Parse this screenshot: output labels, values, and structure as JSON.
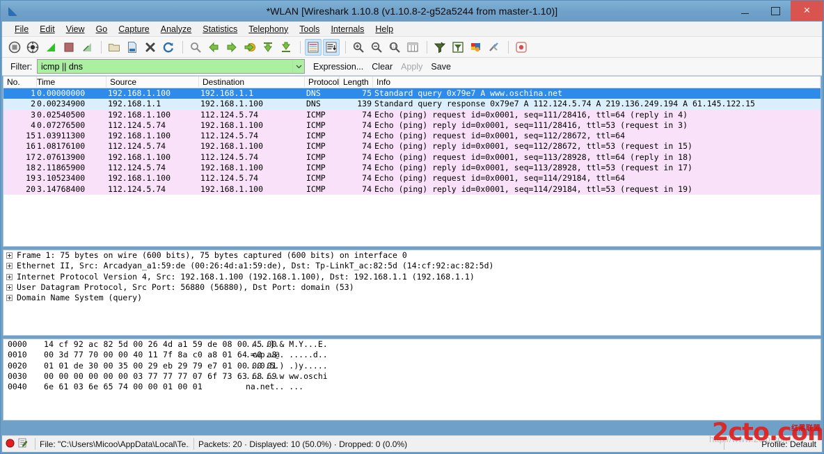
{
  "window": {
    "title": "*WLAN  [Wireshark 1.10.8 (v1.10.8-2-g52a5244 from master-1.10)]",
    "logo_icon": "wireshark-fin-icon",
    "minimize_label": "",
    "maximize_label": "",
    "close_label": "×"
  },
  "menubar": {
    "items": [
      {
        "label": "File"
      },
      {
        "label": "Edit"
      },
      {
        "label": "View"
      },
      {
        "label": "Go"
      },
      {
        "label": "Capture"
      },
      {
        "label": "Analyze"
      },
      {
        "label": "Statistics"
      },
      {
        "label": "Telephony"
      },
      {
        "label": "Tools"
      },
      {
        "label": "Internals"
      },
      {
        "label": "Help"
      }
    ]
  },
  "toolbar": {
    "buttons": [
      {
        "name": "interfaces-icon"
      },
      {
        "name": "capture-options-icon"
      },
      {
        "name": "start-capture-icon"
      },
      {
        "name": "stop-capture-icon"
      },
      {
        "name": "restart-capture-icon"
      },
      {
        "name": "open-file-icon"
      },
      {
        "name": "save-file-icon"
      },
      {
        "name": "close-file-icon"
      },
      {
        "name": "reload-file-icon"
      },
      {
        "name": "find-packet-icon"
      },
      {
        "name": "go-back-icon"
      },
      {
        "name": "go-forward-icon"
      },
      {
        "name": "go-to-packet-icon"
      },
      {
        "name": "go-to-first-icon"
      },
      {
        "name": "go-to-last-icon"
      },
      {
        "name": "colorize-icon"
      },
      {
        "name": "auto-scroll-icon"
      },
      {
        "name": "zoom-in-icon"
      },
      {
        "name": "zoom-out-icon"
      },
      {
        "name": "zoom-reset-icon"
      },
      {
        "name": "resize-columns-icon"
      },
      {
        "name": "capture-filters-icon"
      },
      {
        "name": "display-filters-icon"
      },
      {
        "name": "coloring-rules-icon"
      },
      {
        "name": "preferences-icon"
      },
      {
        "name": "help-contents-icon"
      }
    ]
  },
  "filterbar": {
    "label": "Filter:",
    "value": "icmp || dns",
    "placeholder": "",
    "dropdown_icon": "chevron-down-icon",
    "expression_label": "Expression...",
    "clear_label": "Clear",
    "apply_label": "Apply",
    "save_label": "Save",
    "apply_disabled": true,
    "filter_bg_color": "#aaf0a0"
  },
  "packet_list": {
    "columns": [
      "No.",
      "Time",
      "Source",
      "Destination",
      "Protocol",
      "Length",
      "Info"
    ],
    "rows": [
      {
        "no": "1",
        "time": "0.00000000",
        "source": "192.168.1.100",
        "destination": "192.168.1.1",
        "protocol": "DNS",
        "length": "75",
        "info": "Standard query 0x79e7  A www.oschina.net",
        "style": "sel"
      },
      {
        "no": "2",
        "time": "0.00234900",
        "source": "192.168.1.1",
        "destination": "192.168.1.100",
        "protocol": "DNS",
        "length": "139",
        "info": "Standard query response 0x79e7  A 112.124.5.74 A 219.136.249.194 A 61.145.122.15",
        "style": "dns"
      },
      {
        "no": "3",
        "time": "0.02540500",
        "source": "192.168.1.100",
        "destination": "112.124.5.74",
        "protocol": "ICMP",
        "length": "74",
        "info": "Echo (ping) request  id=0x0001, seq=111/28416, ttl=64 (reply in 4)",
        "style": "icmp"
      },
      {
        "no": "4",
        "time": "0.07276500",
        "source": "112.124.5.74",
        "destination": "192.168.1.100",
        "protocol": "ICMP",
        "length": "74",
        "info": "Echo (ping) reply    id=0x0001, seq=111/28416, ttl=53 (request in 3)",
        "style": "icmp"
      },
      {
        "no": "15",
        "time": "1.03911300",
        "source": "192.168.1.100",
        "destination": "112.124.5.74",
        "protocol": "ICMP",
        "length": "74",
        "info": "Echo (ping) request  id=0x0001, seq=112/28672, ttl=64",
        "style": "icmp"
      },
      {
        "no": "16",
        "time": "1.08176100",
        "source": "112.124.5.74",
        "destination": "192.168.1.100",
        "protocol": "ICMP",
        "length": "74",
        "info": "Echo (ping) reply    id=0x0001, seq=112/28672, ttl=53 (request in 15)",
        "style": "icmp"
      },
      {
        "no": "17",
        "time": "2.07613900",
        "source": "192.168.1.100",
        "destination": "112.124.5.74",
        "protocol": "ICMP",
        "length": "74",
        "info": "Echo (ping) request  id=0x0001, seq=113/28928, ttl=64 (reply in 18)",
        "style": "icmp"
      },
      {
        "no": "18",
        "time": "2.11865900",
        "source": "112.124.5.74",
        "destination": "192.168.1.100",
        "protocol": "ICMP",
        "length": "74",
        "info": "Echo (ping) reply    id=0x0001, seq=113/28928, ttl=53 (request in 17)",
        "style": "icmp"
      },
      {
        "no": "19",
        "time": "3.10523400",
        "source": "192.168.1.100",
        "destination": "112.124.5.74",
        "protocol": "ICMP",
        "length": "74",
        "info": "Echo (ping) request  id=0x0001, seq=114/29184, ttl=64",
        "style": "icmp"
      },
      {
        "no": "20",
        "time": "3.14768400",
        "source": "112.124.5.74",
        "destination": "192.168.1.100",
        "protocol": "ICMP",
        "length": "74",
        "info": "Echo (ping) reply    id=0x0001, seq=114/29184, ttl=53 (request in 19)",
        "style": "icmp"
      }
    ]
  },
  "packet_details": {
    "rows": [
      {
        "text": "Frame 1: 75 bytes on wire (600 bits), 75 bytes captured (600 bits) on interface 0"
      },
      {
        "text": "Ethernet II, Src: Arcadyan_a1:59:de (00:26:4d:a1:59:de), Dst: Tp-LinkT_ac:82:5d (14:cf:92:ac:82:5d)"
      },
      {
        "text": "Internet Protocol Version 4, Src: 192.168.1.100 (192.168.1.100), Dst: 192.168.1.1 (192.168.1.1)"
      },
      {
        "text": "User Datagram Protocol, Src Port: 56880 (56880), Dst Port: domain (53)"
      },
      {
        "text": "Domain Name System (query)"
      }
    ]
  },
  "packet_bytes": {
    "rows": [
      {
        "offset": "0000",
        "hex": "14 cf 92 ac 82 5d 00 26  4d a1 59 de 08 00 45 00",
        "ascii": ".....].& M.Y...E."
      },
      {
        "offset": "0010",
        "hex": "00 3d 77 70 00 00 40 11  7f 8a c0 a8 01 64 c0 a8",
        "ascii": ".=wp..@. .....d.."
      },
      {
        "offset": "0020",
        "hex": "01 01 de 30 00 35 00 29  eb 29 79 e7 01 00 00 01",
        "ascii": "...0.5.) .)y....."
      },
      {
        "offset": "0030",
        "hex": "00 00 00 00 00 00 03 77  77 77 07 6f 73 63 68 69",
        "ascii": ".......w ww.oschi"
      },
      {
        "offset": "0040",
        "hex": "6e 61 03 6e 65 74 00 00  01 00 01",
        "ascii": "na.net.. ..."
      }
    ]
  },
  "statusbar": {
    "expert_icon": "expert-info-error-icon",
    "annotation_icon": "capture-comment-icon",
    "file_text": "File: \"C:\\Users\\Micoo\\AppData\\Local\\Te...",
    "counts_text": "Packets: 20 · Displayed: 10 (50.0%)  · Dropped: 0 (0.0%)",
    "profile_text": "Profile: Default"
  },
  "watermark": {
    "main": "2cto.com",
    "chinese": "红黑联盟",
    "sub": "http://www.2cto.com"
  },
  "colors": {
    "titlebar": "#6fa0c8",
    "selected_row": "#2e8bea",
    "dns_row": "#daeffb",
    "icmp_row": "#f9e2f9",
    "filter_green": "#aaf0a0",
    "close_red": "#d9534f",
    "watermark_red": "#e02020"
  }
}
